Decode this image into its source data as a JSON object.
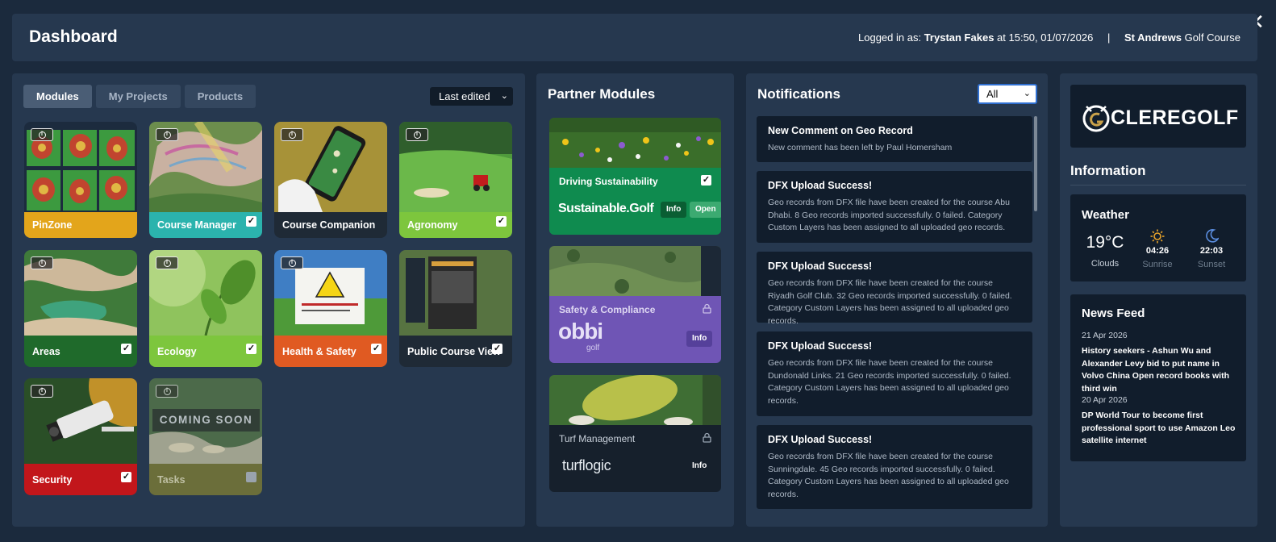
{
  "window": {
    "close_label": "✕"
  },
  "header": {
    "title": "Dashboard",
    "logged_in_prefix": "Logged in as:",
    "user": "Trystan Fakes",
    "at_text": "at 15:50, 01/07/2026",
    "separator": "|",
    "course_bold": "St Andrews",
    "course_rest": "Golf Course"
  },
  "modules": {
    "tabs": [
      "Modules",
      "My Projects",
      "Products"
    ],
    "active_tab": "Modules",
    "sort": {
      "selected": "Last edited"
    },
    "coming_soon_label": "COMING SOON",
    "tiles": [
      {
        "label": "PinZone",
        "color": "#e3a51b",
        "checked": null
      },
      {
        "label": "Course Manager",
        "color": "#2bb3ad",
        "checked": true
      },
      {
        "label": "Course Companion",
        "color": "#1f2a36",
        "checked": null
      },
      {
        "label": "Agronomy",
        "color": "#7dc63d",
        "checked": true
      },
      {
        "label": "Areas",
        "color": "#1f6a2b",
        "checked": true
      },
      {
        "label": "Ecology",
        "color": "#7dc63d",
        "checked": true
      },
      {
        "label": "Health & Safety",
        "color": "#e05a22",
        "checked": true
      },
      {
        "label": "Public Course View",
        "color": "#1f2a36",
        "checked": true
      },
      {
        "label": "Security",
        "color": "#c2161b",
        "checked": true
      },
      {
        "label": "Tasks",
        "color": "#6b6e3a",
        "checked": false
      }
    ]
  },
  "partners": {
    "title": "Partner Modules",
    "cards": [
      {
        "name": "Driving Sustainability",
        "logo": "Sustainable.Golf",
        "buttons": [
          "Info",
          "Open"
        ],
        "color": "#0f8b4f",
        "checked": true,
        "locked": false
      },
      {
        "name": "Safety & Compliance",
        "logo": "obbi",
        "logo_sub": "golf",
        "buttons": [
          "Info"
        ],
        "color": "#6f55b5",
        "checked": false,
        "locked": true
      },
      {
        "name": "Turf Management",
        "logo": "turflogic",
        "buttons": [
          "Info"
        ],
        "color": "#16202c",
        "checked": false,
        "locked": true
      }
    ]
  },
  "notifications": {
    "title": "Notifications",
    "filter": "All",
    "items": [
      {
        "title": "New Comment on Geo Record",
        "body": "New comment has been left by Paul Homersham"
      },
      {
        "title": "DFX Upload Success!",
        "body": "Geo records from DFX file have been created for the course Abu Dhabi. 8 Geo records imported successfully. 0 failed. Category Custom Layers has been assigned to all uploaded geo records."
      },
      {
        "title": "DFX Upload Success!",
        "body": "Geo records from DFX file have been created for the course Riyadh Golf Club. 32 Geo records imported successfully. 0 failed. Category Custom Layers has been assigned to all uploaded geo records."
      },
      {
        "title": "DFX Upload Success!",
        "body": "Geo records from DFX file have been created for the course Dundonald Links. 21 Geo records imported successfully. 0 failed. Category Custom Layers has been assigned to all uploaded geo records."
      },
      {
        "title": "DFX Upload Success!",
        "body": "Geo records from DFX file have been created for the course Sunningdale. 45 Geo records imported successfully. 0 failed. Category Custom Layers has been assigned to all uploaded geo records."
      }
    ]
  },
  "info": {
    "logo_text": "CLEREGOLF",
    "section_title": "Information",
    "weather": {
      "title": "Weather",
      "temp": "19°C",
      "condition": "Clouds",
      "sunrise_time": "04:26",
      "sunrise_label": "Sunrise",
      "sunset_time": "22:03",
      "sunset_label": "Sunset"
    },
    "news": {
      "title": "News Feed",
      "items": [
        {
          "date": "21 Apr 2026",
          "headline": "History seekers - Ashun Wu and Alexander Levy bid to put name in Volvo China Open record books with third win"
        },
        {
          "date": "20 Apr 2026",
          "headline": "DP World Tour to become first professional sport to use Amazon Leo satellite internet"
        }
      ]
    }
  },
  "colors": {
    "panel": "#26384f",
    "page": "#1b2a3d",
    "card": "#111d2c"
  }
}
